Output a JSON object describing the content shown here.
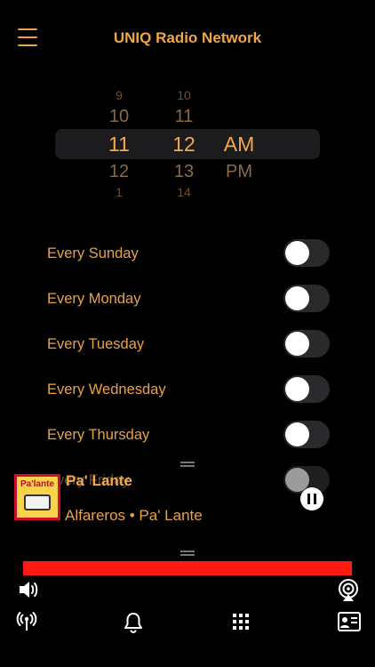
{
  "header": {
    "title": "UNIQ Radio Network"
  },
  "picker": {
    "hours": [
      "9",
      "10",
      "11",
      "12",
      "1"
    ],
    "minutes": [
      "10",
      "11",
      "12",
      "13",
      "14"
    ],
    "periods": [
      "AM",
      "PM"
    ],
    "selected": {
      "hour": "11",
      "minute": "12",
      "period": "AM"
    }
  },
  "schedule": {
    "days": [
      {
        "label": "Every Sunday",
        "on": false
      },
      {
        "label": "Every Monday",
        "on": false
      },
      {
        "label": "Every Tuesday",
        "on": false
      },
      {
        "label": "Every Wednesday",
        "on": false
      },
      {
        "label": "Every Thursday",
        "on": false
      },
      {
        "label": "Every Friday",
        "on": false
      }
    ]
  },
  "player": {
    "title": "Pa' Lante",
    "subtitle": "Alfareros • Pa' Lante",
    "artwork_text": "Pa'lante",
    "progress_percent": 100,
    "state": "playing"
  },
  "controls": {
    "volume_icon": "speaker-icon",
    "airplay_icon": "airplay-icon"
  },
  "tabbar": {
    "items": [
      {
        "icon": "radio-tower-icon"
      },
      {
        "icon": "bell-icon"
      },
      {
        "icon": "grid-icon"
      },
      {
        "icon": "contact-card-icon"
      }
    ]
  },
  "colors": {
    "accent": "#e8a24a",
    "progress": "#ff1a12",
    "background": "#000000"
  }
}
